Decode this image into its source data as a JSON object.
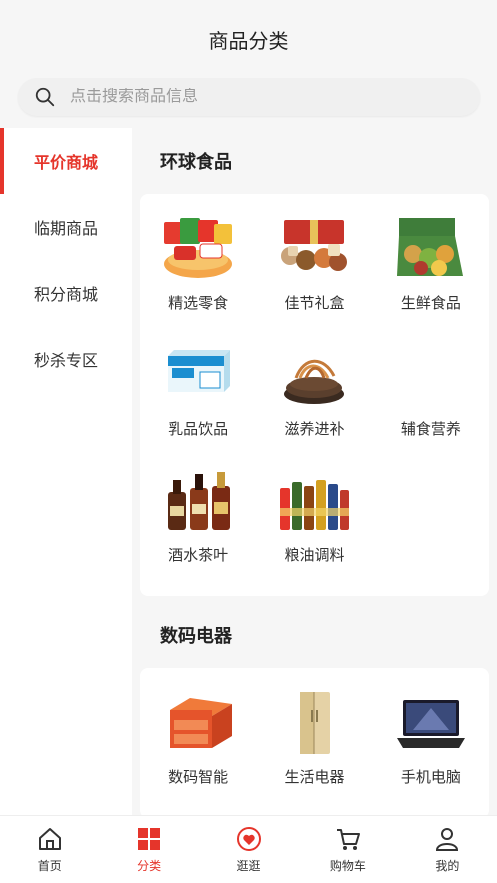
{
  "header": {
    "title": "商品分类"
  },
  "search": {
    "placeholder": "点击搜索商品信息"
  },
  "sidebar": {
    "items": [
      {
        "label": "平价商城",
        "active": true
      },
      {
        "label": "临期商品",
        "active": false
      },
      {
        "label": "积分商城",
        "active": false
      },
      {
        "label": "秒杀专区",
        "active": false
      }
    ]
  },
  "sections": [
    {
      "title": "环球食品",
      "items": [
        {
          "label": "精选零食",
          "icon": "snacks-image"
        },
        {
          "label": "佳节礼盒",
          "icon": "gift-box-image"
        },
        {
          "label": "生鲜食品",
          "icon": "fresh-produce-image"
        },
        {
          "label": "乳品饮品",
          "icon": "milk-carton-image"
        },
        {
          "label": "滋养进补",
          "icon": "cordyceps-image"
        },
        {
          "label": "辅食营养",
          "icon": ""
        },
        {
          "label": "酒水茶叶",
          "icon": "liquor-bottles-image"
        },
        {
          "label": "粮油调料",
          "icon": "condiments-image"
        }
      ]
    },
    {
      "title": "数码电器",
      "items": [
        {
          "label": "数码智能",
          "icon": "orange-drawer-box-image"
        },
        {
          "label": "生活电器",
          "icon": "refrigerator-image"
        },
        {
          "label": "手机电脑",
          "icon": "laptop-image"
        }
      ]
    }
  ],
  "tabbar": {
    "items": [
      {
        "label": "首页",
        "icon": "home-icon",
        "active": false
      },
      {
        "label": "分类",
        "icon": "category-icon",
        "active": true
      },
      {
        "label": "逛逛",
        "icon": "heart-bubble-icon",
        "active": false
      },
      {
        "label": "购物车",
        "icon": "cart-icon",
        "active": false
      },
      {
        "label": "我的",
        "icon": "user-icon",
        "active": false
      }
    ]
  },
  "colors": {
    "accent": "#e5352b",
    "background": "#f6f6f6",
    "card": "#ffffff"
  }
}
